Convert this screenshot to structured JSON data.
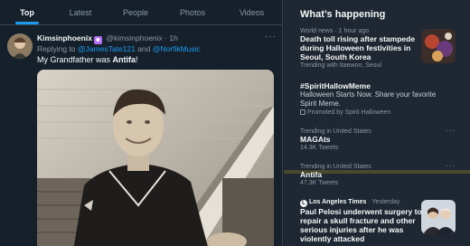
{
  "tabs": [
    "Top",
    "Latest",
    "People",
    "Photos",
    "Videos"
  ],
  "tweet": {
    "display_name": "Kimsinphoenix",
    "badge": "😈",
    "handle": "@kimsinphoenix",
    "time": "1h",
    "reply_prefix": "Replying to",
    "mention1": "@JamesTate121",
    "reply_and": "and",
    "mention2": "@NorfikMusic",
    "text_prefix": "My Grandfather was",
    "text_bold": "Antifa",
    "text_suffix": "!"
  },
  "sidebar": {
    "title": "What’s happening",
    "trends": [
      {
        "meta": "World news · 1 hour ago",
        "title_lines": [
          "Death toll rising after stampede",
          "during Halloween festivities in",
          "Seoul, South Korea"
        ],
        "sub": "Trending with Itaewon, Seoul"
      },
      {
        "title": "#SpiritHallowMeme",
        "desc_lines": [
          "Halloween Starts Now. Share your favorite",
          "Spirit Meme."
        ],
        "sub": "Promoted by Spirit Halloween"
      },
      {
        "meta": "Trending in United States",
        "title": "MAGAts",
        "sub": "14.3K Tweets"
      },
      {
        "meta": "Trending in United States",
        "title": "Antifa",
        "sub": "47.3K Tweets"
      },
      {
        "meta_source": "Los Angeles Times",
        "meta_time": "· Yesterday",
        "title_lines": [
          "Paul Pelosi underwent surgery to",
          "repair a skull fracture and other",
          "serious injuries after he was",
          "violently attacked"
        ]
      }
    ]
  },
  "colors": {
    "accent": "#1d9bf0",
    "bg": "#15202b",
    "sidebar_bg": "#1e2732"
  }
}
